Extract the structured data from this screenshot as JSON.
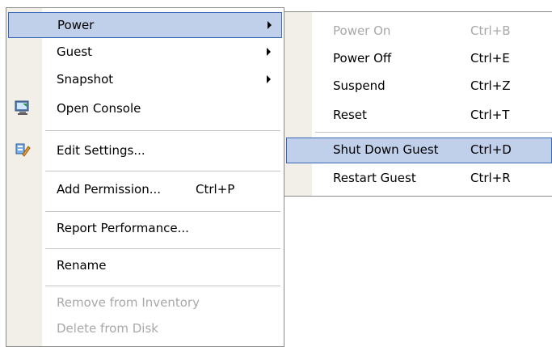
{
  "main_menu": {
    "power": "Power",
    "guest": "Guest",
    "snapshot": "Snapshot",
    "open_console": "Open Console",
    "edit_settings": "Edit Settings...",
    "add_permission": "Add Permission...",
    "add_permission_shortcut": "Ctrl+P",
    "report_performance": "Report Performance...",
    "rename": "Rename",
    "remove_from_inventory": "Remove from Inventory",
    "delete_from_disk": "Delete from Disk"
  },
  "power_submenu": {
    "power_on": "Power On",
    "power_on_shortcut": "Ctrl+B",
    "power_off": "Power Off",
    "power_off_shortcut": "Ctrl+E",
    "suspend": "Suspend",
    "suspend_shortcut": "Ctrl+Z",
    "reset": "Reset",
    "reset_shortcut": "Ctrl+T",
    "shut_down_guest": "Shut Down Guest",
    "shut_down_guest_shortcut": "Ctrl+D",
    "restart_guest": "Restart Guest",
    "restart_guest_shortcut": "Ctrl+R"
  },
  "colors": {
    "highlight_fill": "#c0cfea",
    "highlight_border": "#3a68b8",
    "gutter": "#f1efe7",
    "disabled_text": "#a8a8a8"
  },
  "icons": [
    "console-icon",
    "edit-settings-icon",
    "submenu-arrow-icon"
  ]
}
